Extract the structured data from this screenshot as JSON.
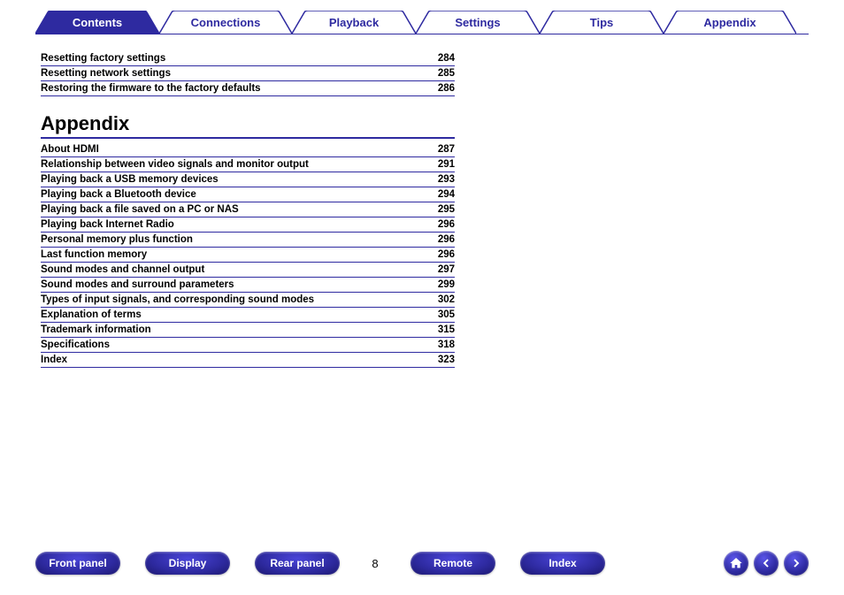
{
  "topnav": {
    "tabs": [
      {
        "label": "Contents",
        "active": true
      },
      {
        "label": "Connections",
        "active": false
      },
      {
        "label": "Playback",
        "active": false
      },
      {
        "label": "Settings",
        "active": false
      },
      {
        "label": "Tips",
        "active": false
      },
      {
        "label": "Appendix",
        "active": false
      }
    ]
  },
  "toc_upper": [
    {
      "label": "Resetting factory settings",
      "page": "284"
    },
    {
      "label": "Resetting network settings",
      "page": "285"
    },
    {
      "label": "Restoring the firmware to the factory defaults",
      "page": "286"
    }
  ],
  "section_title": "Appendix",
  "toc_appendix": [
    {
      "label": "About HDMI",
      "page": "287"
    },
    {
      "label": "Relationship between video signals and monitor output",
      "page": "291"
    },
    {
      "label": "Playing back a USB memory devices",
      "page": "293"
    },
    {
      "label": "Playing back a Bluetooth device",
      "page": "294"
    },
    {
      "label": "Playing back a file saved on a PC or NAS",
      "page": "295"
    },
    {
      "label": "Playing back Internet Radio",
      "page": "296"
    },
    {
      "label": "Personal memory plus function",
      "page": "296"
    },
    {
      "label": "Last function memory",
      "page": "296"
    },
    {
      "label": "Sound modes and channel output",
      "page": "297"
    },
    {
      "label": "Sound modes and surround parameters",
      "page": "299"
    },
    {
      "label": "Types of input signals, and corresponding sound modes",
      "page": "302"
    },
    {
      "label": "Explanation of terms",
      "page": "305"
    },
    {
      "label": "Trademark information",
      "page": "315"
    },
    {
      "label": "Specifications",
      "page": "318"
    },
    {
      "label": "Index",
      "page": "323"
    }
  ],
  "bottombar": {
    "front_panel": "Front panel",
    "display": "Display",
    "rear_panel": "Rear panel",
    "page_number": "8",
    "remote": "Remote",
    "index_btn": "Index"
  },
  "icons": {
    "home": "home-icon",
    "back": "back-icon",
    "fwd": "forward-icon"
  }
}
